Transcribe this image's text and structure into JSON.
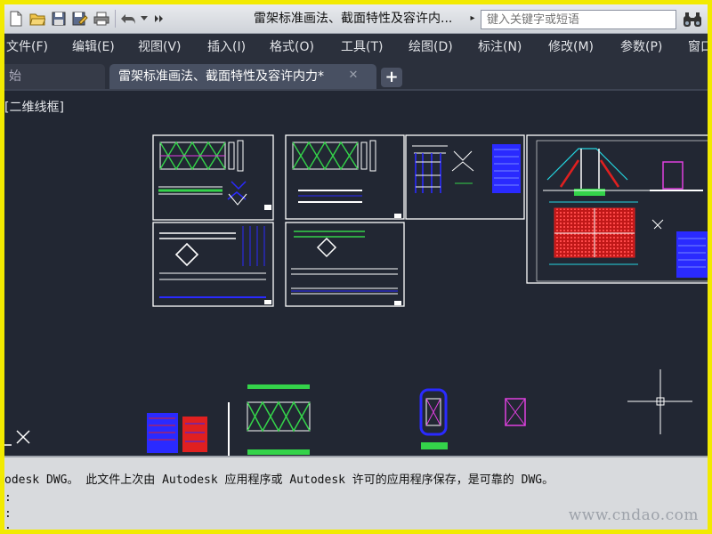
{
  "quick_access": {
    "doc_title": "雷架标准画法、截面特性及容许内...",
    "title_more": "▸",
    "search_placeholder": "键入关键字或短语"
  },
  "menu": {
    "items": [
      "文件(F)",
      "编辑(E)",
      "视图(V)",
      "插入(I)",
      "格式(O)",
      "工具(T)",
      "绘图(D)",
      "标注(N)",
      "修改(M)",
      "参数(P)",
      "窗口"
    ]
  },
  "tabs": {
    "start_label": "始",
    "active_label": "雷架标准画法、截面特性及容许内力*",
    "close_glyph": "✕",
    "add_glyph": "+"
  },
  "viewport": {
    "label": "[二维线框]"
  },
  "command_line": {
    "history": "odesk DWG。  此文件上次由 Autodesk 应用程序或 Autodesk 许可的应用程序保存，是可靠的 DWG。",
    "prompts": [
      ":",
      ":",
      ":"
    ]
  },
  "watermark": "www.cndao.com",
  "colors": {
    "page_border": "#f2ea00",
    "canvas_bg": "#222733",
    "sheet_frame": "#ffffff",
    "truss_green": "#34d34a",
    "dim_blue": "#2a2aff",
    "accent_red": "#e02020",
    "accent_magenta": "#e040e0",
    "accent_cyan": "#25d6e0"
  }
}
